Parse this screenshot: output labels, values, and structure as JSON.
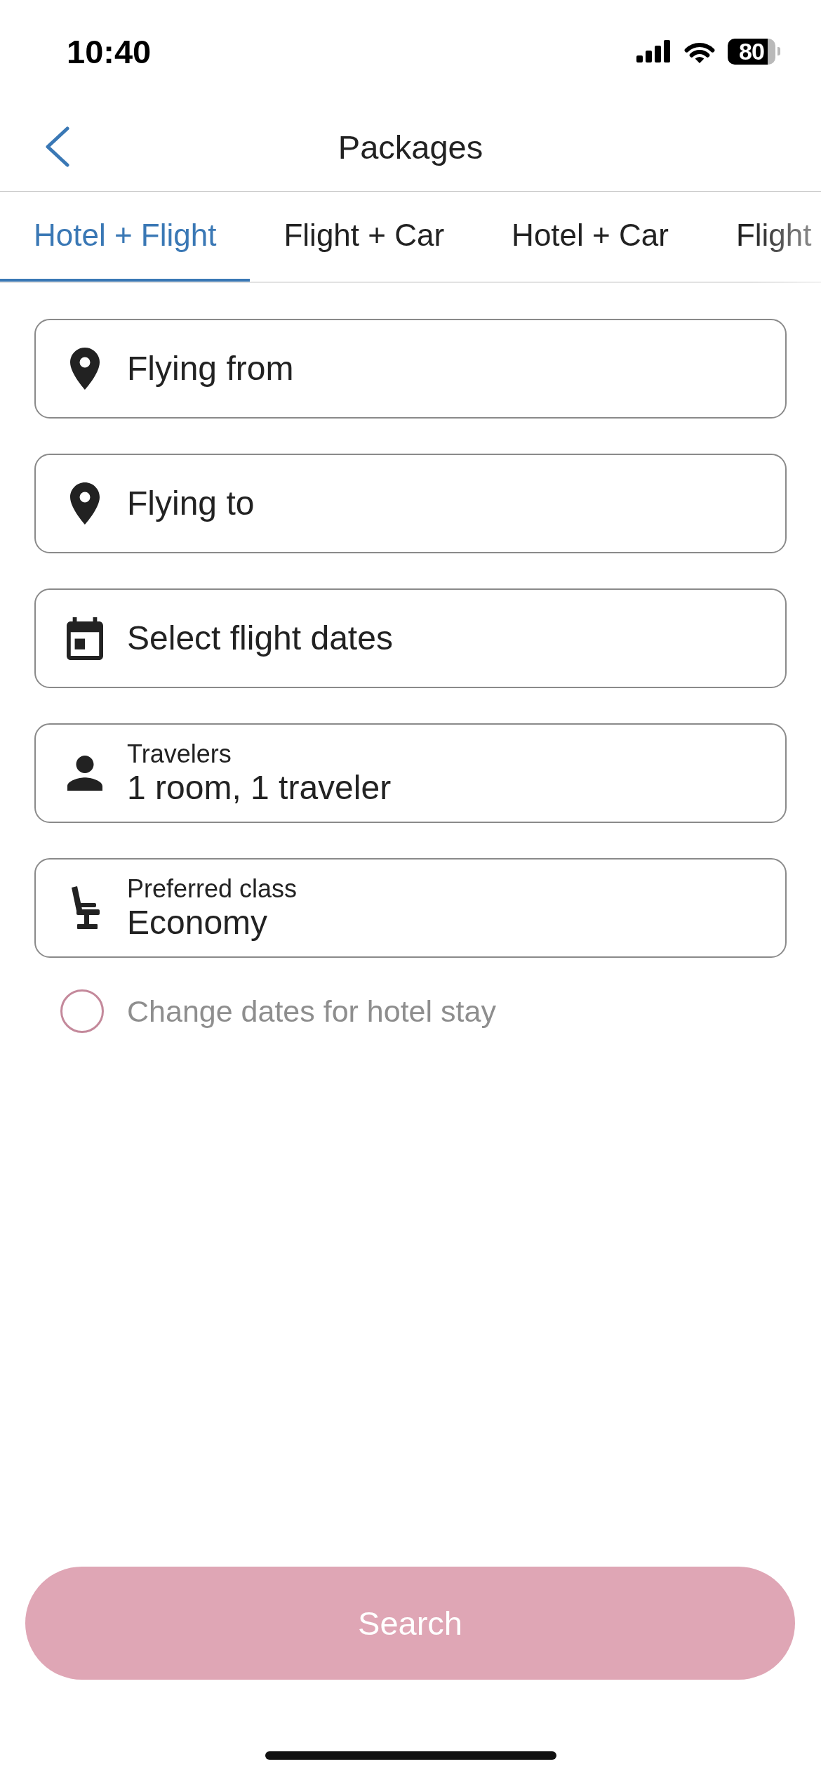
{
  "status_bar": {
    "time": "10:40",
    "battery": "80"
  },
  "header": {
    "title": "Packages"
  },
  "tabs": [
    {
      "label": "Hotel + Flight",
      "selected": true
    },
    {
      "label": "Flight + Car",
      "selected": false
    },
    {
      "label": "Hotel + Car",
      "selected": false
    },
    {
      "label": "Flight",
      "selected": false
    }
  ],
  "fields": [
    {
      "kind": "location",
      "label": "Flying from"
    },
    {
      "kind": "location",
      "label": "Flying to"
    },
    {
      "kind": "date",
      "label": "Select flight dates"
    },
    {
      "kind": "travelers",
      "label": "Travelers",
      "value": "1 room, 1 traveler"
    },
    {
      "kind": "seat",
      "label": "Preferred class",
      "value": "Economy"
    }
  ],
  "hotel_dates_option": {
    "label": "Change dates for hotel stay",
    "checked": false,
    "disabled": true
  },
  "search_button": {
    "label": "Search",
    "disabled": true
  }
}
